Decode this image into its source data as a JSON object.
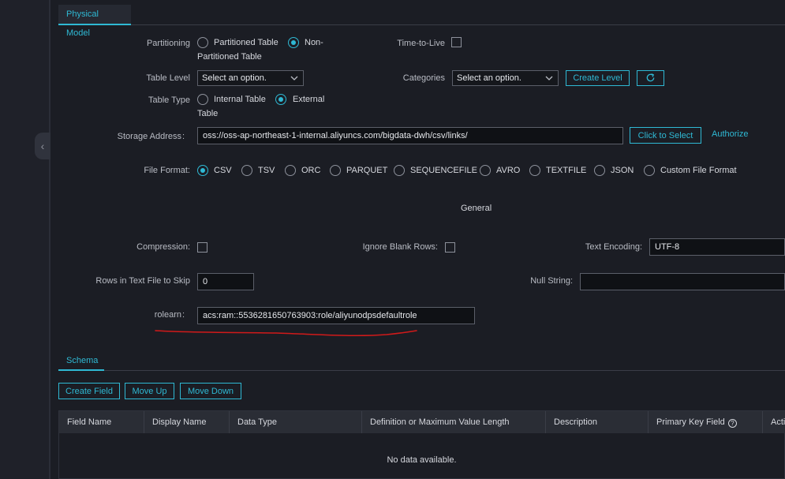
{
  "tabs": {
    "physical_model": "Physical Model",
    "schema": "Schema"
  },
  "partitioning": {
    "label": "Partitioning",
    "opt_partitioned": "Partitioned Table",
    "opt_non_line1": "Non-",
    "opt_non_line2": "Partitioned Table",
    "selected": "Non-Partitioned Table"
  },
  "ttl": {
    "label": "Time-to-Live"
  },
  "table_level": {
    "label": "Table Level",
    "value": "Select an option."
  },
  "categories": {
    "label": "Categories",
    "value": "Select an option."
  },
  "buttons": {
    "create_level": "Create Level",
    "click_to_select": "Click to Select",
    "create_field": "Create Field",
    "move_up": "Move Up",
    "move_down": "Move Down"
  },
  "table_type": {
    "label": "Table Type",
    "opt_internal": "Internal Table",
    "opt_external_line1": "External",
    "opt_external_line2": "Table",
    "selected": "External Table"
  },
  "storage": {
    "label": "Storage Address",
    "colon": ":",
    "value": "oss://oss-ap-northeast-1-internal.aliyuncs.com/bigdata-dwh/csv/links/",
    "authorize": "Authorize"
  },
  "file_format": {
    "label": "File Format:",
    "options": [
      "CSV",
      "TSV",
      "ORC",
      "PARQUET",
      "SEQUENCEFILE",
      "AVRO",
      "TEXTFILE",
      "JSON",
      "Custom File Format"
    ],
    "selected": "CSV"
  },
  "general_heading": "General",
  "compression": {
    "label": "Compression:"
  },
  "ignore_blank": {
    "label": "Ignore Blank Rows:"
  },
  "text_encoding": {
    "label": "Text Encoding:",
    "value": "UTF-8"
  },
  "rows_skip": {
    "label": "Rows in Text File to Skip",
    "value": "0"
  },
  "null_string": {
    "label": "Null String:",
    "value": ""
  },
  "rolearn": {
    "label": "rolearn",
    "colon": ":",
    "value": "acs:ram::5536281650763903:role/aliyunodpsdefaultrole"
  },
  "schema_table": {
    "columns": [
      "Field Name",
      "Display Name",
      "Data Type",
      "Definition or Maximum Value Length",
      "Description",
      "Primary Key Field",
      "Acti"
    ],
    "empty_text": "No data available."
  },
  "colors": {
    "accent": "#2fb9d4",
    "annotation": "#d11a1a"
  },
  "icons": {
    "collapse": "chevron-left-icon",
    "refresh": "refresh-icon",
    "help": "help-circle-icon"
  }
}
